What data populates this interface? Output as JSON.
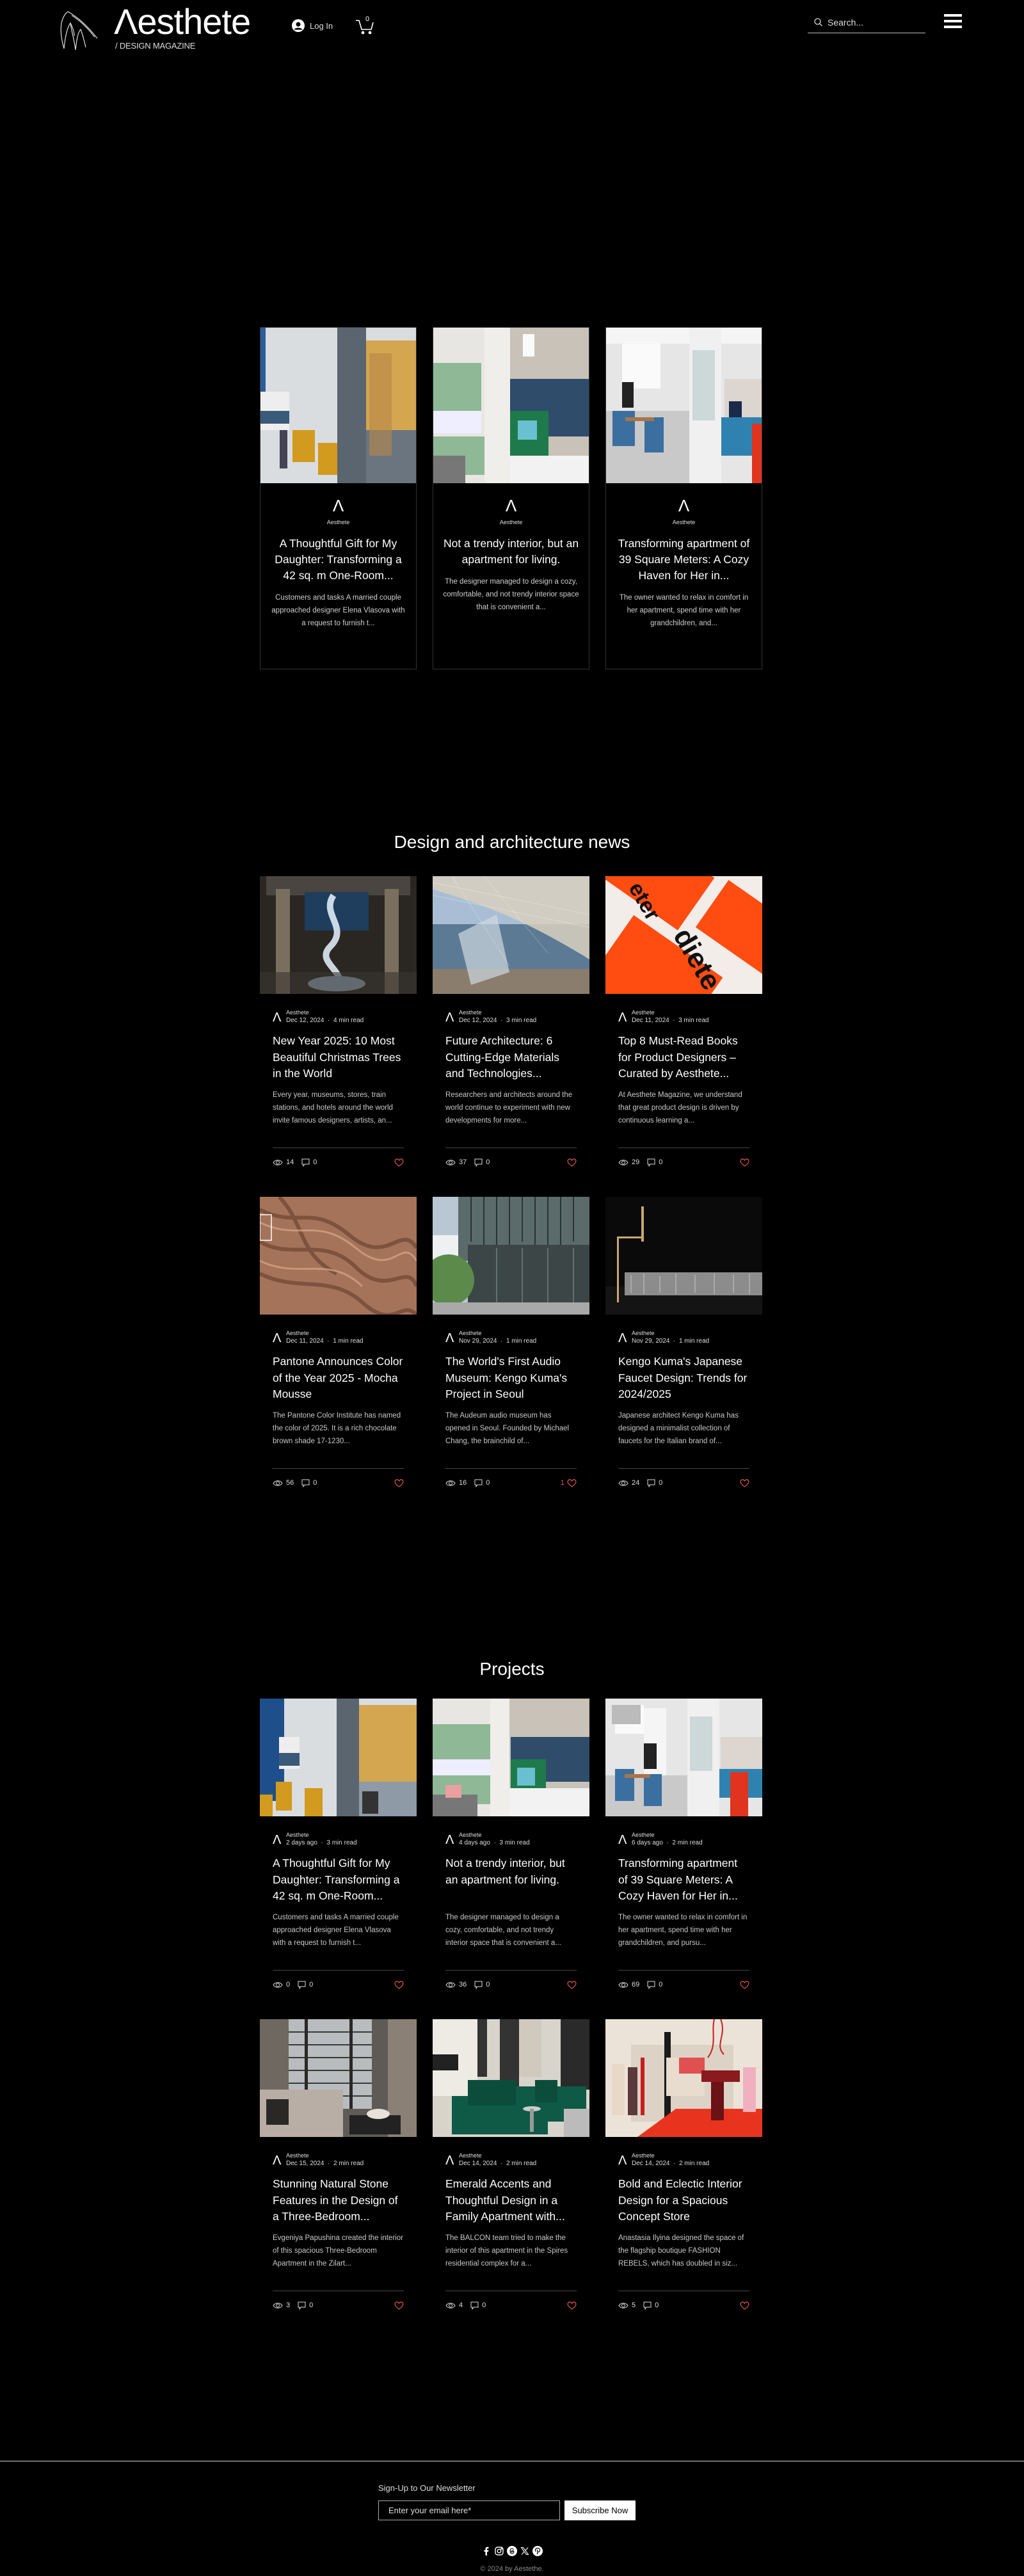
{
  "header": {
    "brand": "Λesthete",
    "tagline": "/ DESIGN MAGAZINE",
    "login_label": "Log In",
    "cart_count": "0",
    "search_placeholder": "Search..."
  },
  "featured": [
    {
      "author": "Aesthete",
      "title": "A Thoughtful Gift for My Daughter: Transforming a 42 sq. m One-Room...",
      "excerpt": "Customers and tasks A married couple approached designer Elena Vlasova with a request to furnish t..."
    },
    {
      "author": "Aesthete",
      "title": "Not a trendy interior, but an apartment for living.",
      "excerpt": "The designer managed to design a cozy, comfortable, and not trendy interior space that is convenient a..."
    },
    {
      "author": "Aesthete",
      "title": "Transforming apartment of 39 Square Meters: A Cozy Haven for Her in...",
      "excerpt": "The owner wanted to relax in comfort in her apartment, spend time with her grandchildren, and..."
    }
  ],
  "news": {
    "title": "Design and architecture news",
    "posts": [
      {
        "author": "Aesthete",
        "date": "Dec 12, 2024",
        "read": "4 min read",
        "title": "New Year 2025: 10 Most Beautiful Christmas Trees in the World",
        "excerpt": "Every year, museums, stores, train stations, and hotels around the world invite famous designers, artists, an...",
        "views": "14",
        "comments": "0",
        "likes": ""
      },
      {
        "author": "Aesthete",
        "date": "Dec 12, 2024",
        "read": "3 min read",
        "title": "Future Architecture: 6 Cutting-Edge Materials and Technologies...",
        "excerpt": "Researchers and architects around the world continue to experiment with new developments for more...",
        "views": "37",
        "comments": "0",
        "likes": ""
      },
      {
        "author": "Aesthete",
        "date": "Dec 11, 2024",
        "read": "3 min read",
        "title": "Top 8 Must-Read Books for Product Designers – Curated by Aesthete...",
        "excerpt": "At Aesthete Magazine, we understand that great product design is driven by continuous learning a...",
        "views": "29",
        "comments": "0",
        "likes": ""
      },
      {
        "author": "Aesthete",
        "date": "Dec 11, 2024",
        "read": "1 min read",
        "title": "Pantone Announces Color of the Year 2025 - Mocha Mousse",
        "excerpt": "The Pantone Color Institute has named the color of 2025. It is a rich chocolate brown shade 17-1230...",
        "views": "56",
        "comments": "0",
        "likes": ""
      },
      {
        "author": "Aesthete",
        "date": "Nov 29, 2024",
        "read": "1 min read",
        "title": "The World's First Audio Museum: Kengo Kuma's Project in Seoul",
        "excerpt": "The Audeum audio museum has opened in Seoul. Founded by Michael Chang, the brainchild of...",
        "views": "16",
        "comments": "0",
        "likes": "1"
      },
      {
        "author": "Aesthete",
        "date": "Nov 29, 2024",
        "read": "1 min read",
        "title": "Kengo Kuma's Japanese Faucet Design: Trends for 2024/2025",
        "excerpt": "Japanese architect Kengo Kuma has designed a minimalist collection of faucets for the Italian brand of...",
        "views": "24",
        "comments": "0",
        "likes": ""
      }
    ]
  },
  "projects": {
    "title": "Projects",
    "posts": [
      {
        "author": "Aesthete",
        "date": "2 days ago",
        "read": "3 min read",
        "title": "A Thoughtful Gift for My Daughter: Transforming a 42 sq. m One-Room...",
        "excerpt": "Customers and tasks A married couple approached designer Elena Vlasova with a request to furnish t...",
        "views": "0",
        "comments": "0",
        "likes": ""
      },
      {
        "author": "Aesthete",
        "date": "4 days ago",
        "read": "3 min read",
        "title": "Not a trendy interior, but an apartment for living.",
        "excerpt": "The designer managed to design a cozy, comfortable, and not trendy interior space that is convenient a...",
        "views": "36",
        "comments": "0",
        "likes": ""
      },
      {
        "author": "Aesthete",
        "date": "6 days ago",
        "read": "2 min read",
        "title": "Transforming apartment of 39 Square Meters: A Cozy Haven for Her in...",
        "excerpt": "The owner wanted to relax in comfort in her apartment, spend time with her grandchildren, and pursu...",
        "views": "69",
        "comments": "0",
        "likes": ""
      },
      {
        "author": "Aesthete",
        "date": "Dec 15, 2024",
        "read": "2 min read",
        "title": "Stunning Natural Stone Features in the Design of a Three-Bedroom...",
        "excerpt": "Evgeniya Papushina created the interior of this spacious Three-Bedroom Apartment in the Zilart...",
        "views": "3",
        "comments": "0",
        "likes": ""
      },
      {
        "author": "Aesthete",
        "date": "Dec 14, 2024",
        "read": "2 min read",
        "title": "Emerald Accents and Thoughtful Design in a Family Apartment with...",
        "excerpt": "The BALCON team tried to make the interior of this apartment in the Spires residential complex for a...",
        "views": "4",
        "comments": "0",
        "likes": ""
      },
      {
        "author": "Aesthete",
        "date": "Dec 14, 2024",
        "read": "2 min read",
        "title": "Bold and Eclectic Interior Design for a Spacious Concept Store",
        "excerpt": "Anastasia Ilyina designed the space of the flagship boutique FASHION REBELS, which has doubled in siz...",
        "views": "5",
        "comments": "0",
        "likes": ""
      }
    ]
  },
  "footer": {
    "newsletter_label": "Sign-Up to Our Newsletter",
    "email_placeholder": "Enter your email here*",
    "subscribe_label": "Subscribe Now",
    "socials": [
      "facebook",
      "instagram",
      "threads",
      "x",
      "pinterest"
    ],
    "copyright": "© 2024 by Aestethe."
  },
  "colors": {
    "background": "#000000",
    "text": "#ffffff",
    "like": "#e05555"
  }
}
